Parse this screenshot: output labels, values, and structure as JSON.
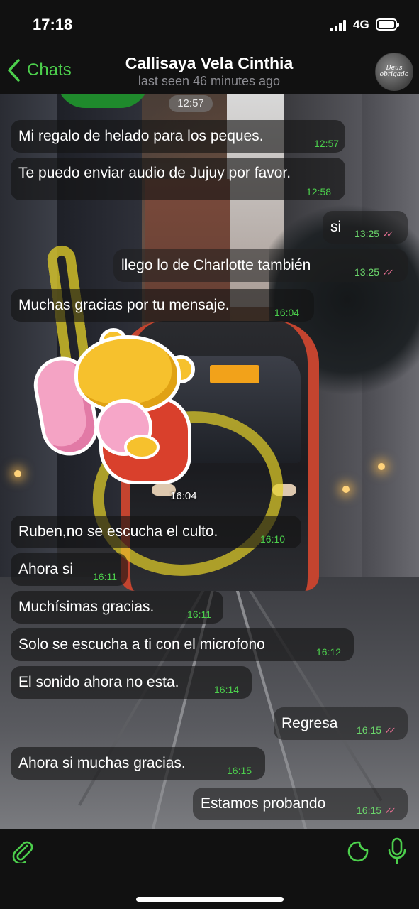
{
  "status_bar": {
    "time": "17:18",
    "network": "4G"
  },
  "header": {
    "back_label": "Chats",
    "contact_name": "Callisaya Vela Cinthia",
    "last_seen": "last seen 46 minutes ago",
    "avatar_text": "Deus obrigado"
  },
  "chat": {
    "date_pill": "12:57",
    "sticker_time": "16:04",
    "messages": [
      {
        "text": "Mi regalo de helado para los peques.",
        "time": "12:57",
        "dir": "in"
      },
      {
        "text": "Te puedo enviar audio de Jujuy por favor.",
        "time": "12:58",
        "dir": "in"
      },
      {
        "text": "si",
        "time": "13:25",
        "dir": "out"
      },
      {
        "text": "llego lo de Charlotte también",
        "time": "13:25",
        "dir": "out"
      },
      {
        "text": "Muchas gracias por tu mensaje.",
        "time": "16:04",
        "dir": "in"
      },
      {
        "text": "Ruben,no se escucha el culto.",
        "time": "16:10",
        "dir": "in"
      },
      {
        "text": "Ahora si",
        "time": "16:11",
        "dir": "in"
      },
      {
        "text": "Muchísimas gracias.",
        "time": "16:11",
        "dir": "in"
      },
      {
        "text": "Solo se escucha a ti con el microfono",
        "time": "16:12",
        "dir": "in"
      },
      {
        "text": "El sonido ahora no esta.",
        "time": "16:14",
        "dir": "in"
      },
      {
        "text": "Regresa",
        "time": "16:15",
        "dir": "out"
      },
      {
        "text": "Ahora si  muchas gracias.",
        "time": "16:15",
        "dir": "in"
      },
      {
        "text": "Estamos probando",
        "time": "16:15",
        "dir": "out"
      }
    ]
  },
  "colors": {
    "accent": "#4ccf4c",
    "read_ticks": "#e06c8e",
    "bar_bg": "#111111"
  },
  "icons": {
    "back": "chevron-left-icon",
    "attach": "paperclip-icon",
    "sticker": "sticker-icon",
    "mic": "microphone-icon"
  }
}
